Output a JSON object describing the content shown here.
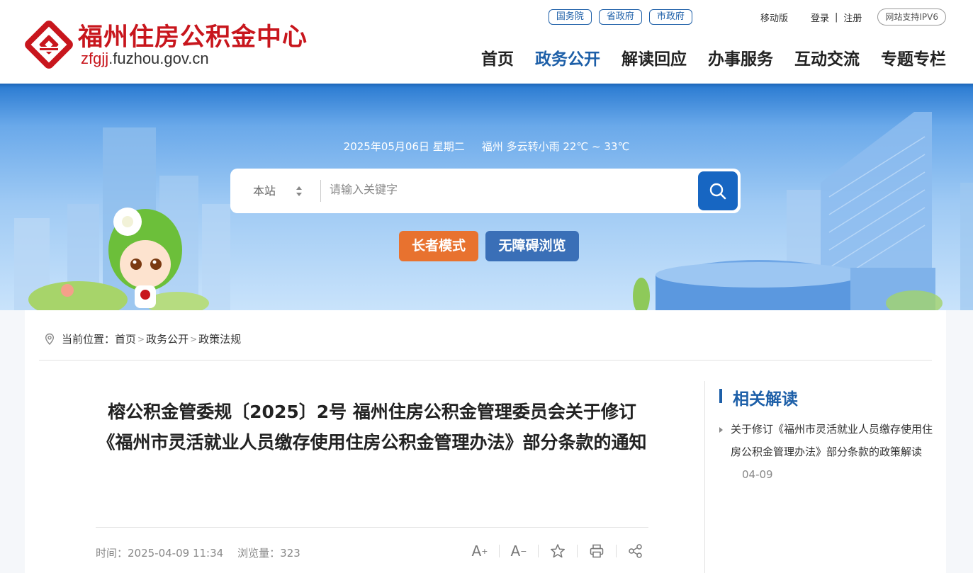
{
  "header": {
    "logo": {
      "title": "福州住房公积金中心",
      "domain_prefix": "zfgjj",
      "domain_rest": ".fuzhou.gov.cn"
    },
    "gov_links": [
      "国务院",
      "省政府",
      "市政府"
    ],
    "mobile": "移动版",
    "login": "登录",
    "separator": "|",
    "register": "注册",
    "ipv6": "网站支持IPV6",
    "nav": [
      {
        "label": "首页",
        "active": false
      },
      {
        "label": "政务公开",
        "active": true
      },
      {
        "label": "解读回应",
        "active": false
      },
      {
        "label": "办事服务",
        "active": false
      },
      {
        "label": "互动交流",
        "active": false
      },
      {
        "label": "专题专栏",
        "active": false
      }
    ]
  },
  "banner": {
    "date": "2025年05月06日 星期二",
    "weather": "福州 多云转小雨 22℃ ~ 33℃",
    "search": {
      "scope": "本站",
      "placeholder": "请输入关键字"
    },
    "elder_mode": "长者模式",
    "accessible": "无障碍浏览"
  },
  "breadcrumb": {
    "prefix": "当前位置：",
    "items": [
      "首页",
      "政务公开",
      "政策法规"
    ],
    "sep": ">"
  },
  "article": {
    "title": "榕公积金管委规〔2025〕2号 福州住房公积金管理委员会关于修订《福州市灵活就业人员缴存使用住房公积金管理办法》部分条款的通知",
    "time": "时间：2025-04-09 11:34",
    "views": "浏览量：323",
    "tools": {
      "font_up": "A",
      "font_up_sup": "+",
      "font_down": "A",
      "font_down_sup": "−"
    }
  },
  "sidebar": {
    "title": "相关解读",
    "items": [
      {
        "text": "关于修订《福州市灵活就业人员缴存使用住房公积金管理办法》部分条款的政策解读",
        "date": "04-09"
      }
    ]
  },
  "colors": {
    "brand_red": "#c8161d",
    "brand_blue": "#1d5fa8",
    "elder_orange": "#e8722f",
    "access_blue": "#3a6fb7"
  }
}
